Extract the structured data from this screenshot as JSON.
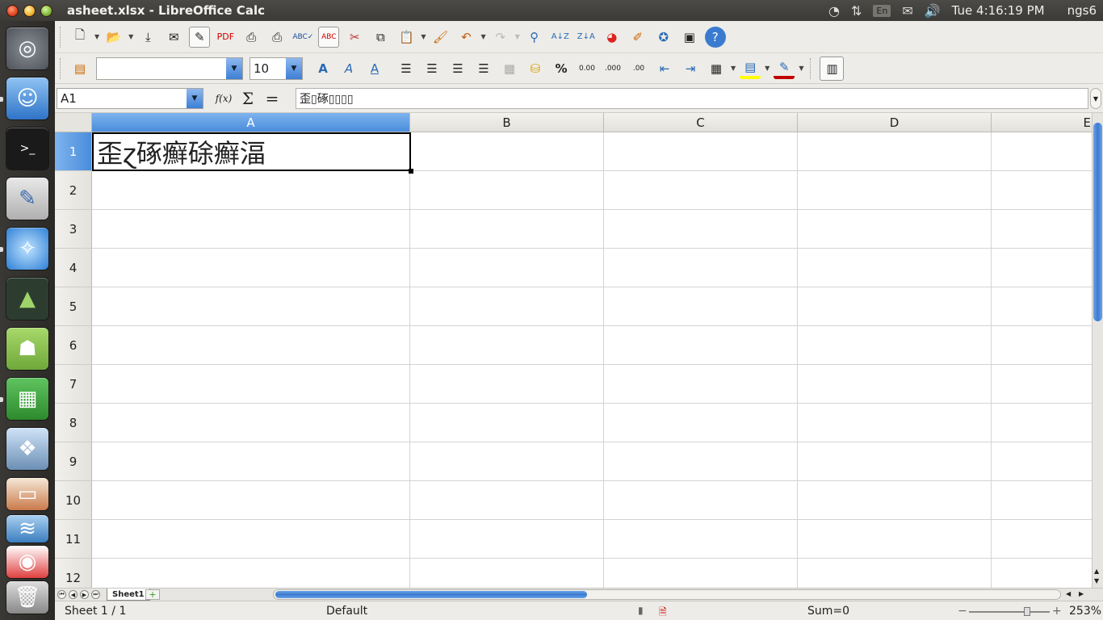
{
  "window": {
    "title": "asheet.xlsx - LibreOffice Calc"
  },
  "tray": {
    "keyboard": "En",
    "clock": "Tue 4:16:19 PM",
    "user": "ngs6"
  },
  "toolbar2": {
    "font_name": "",
    "font_size": "10"
  },
  "formula_bar": {
    "name_box": "A1",
    "fx": "f(x)",
    "sum": "Σ",
    "equals": "=",
    "content": "歪▯硺▯▯▯▯"
  },
  "sheet": {
    "columns": [
      "A",
      "B",
      "C",
      "D",
      "E"
    ],
    "rows": [
      "1",
      "2",
      "3",
      "4",
      "5",
      "6",
      "7",
      "8",
      "9",
      "10",
      "11",
      "12"
    ],
    "active_cell": "A1",
    "a1_value": "歪ɀ硺癬硢癬湢"
  },
  "tabs": {
    "sheet1": "Sheet1",
    "add": "+"
  },
  "status": {
    "sheet_pos": "Sheet 1 / 1",
    "page_style": "Default",
    "sum": "Sum=0",
    "zoom_minus": "−",
    "zoom_plus": "+",
    "zoom": "253%"
  },
  "colors": {
    "accent": "#4a8ddb",
    "launcher": "#2b2a27"
  }
}
